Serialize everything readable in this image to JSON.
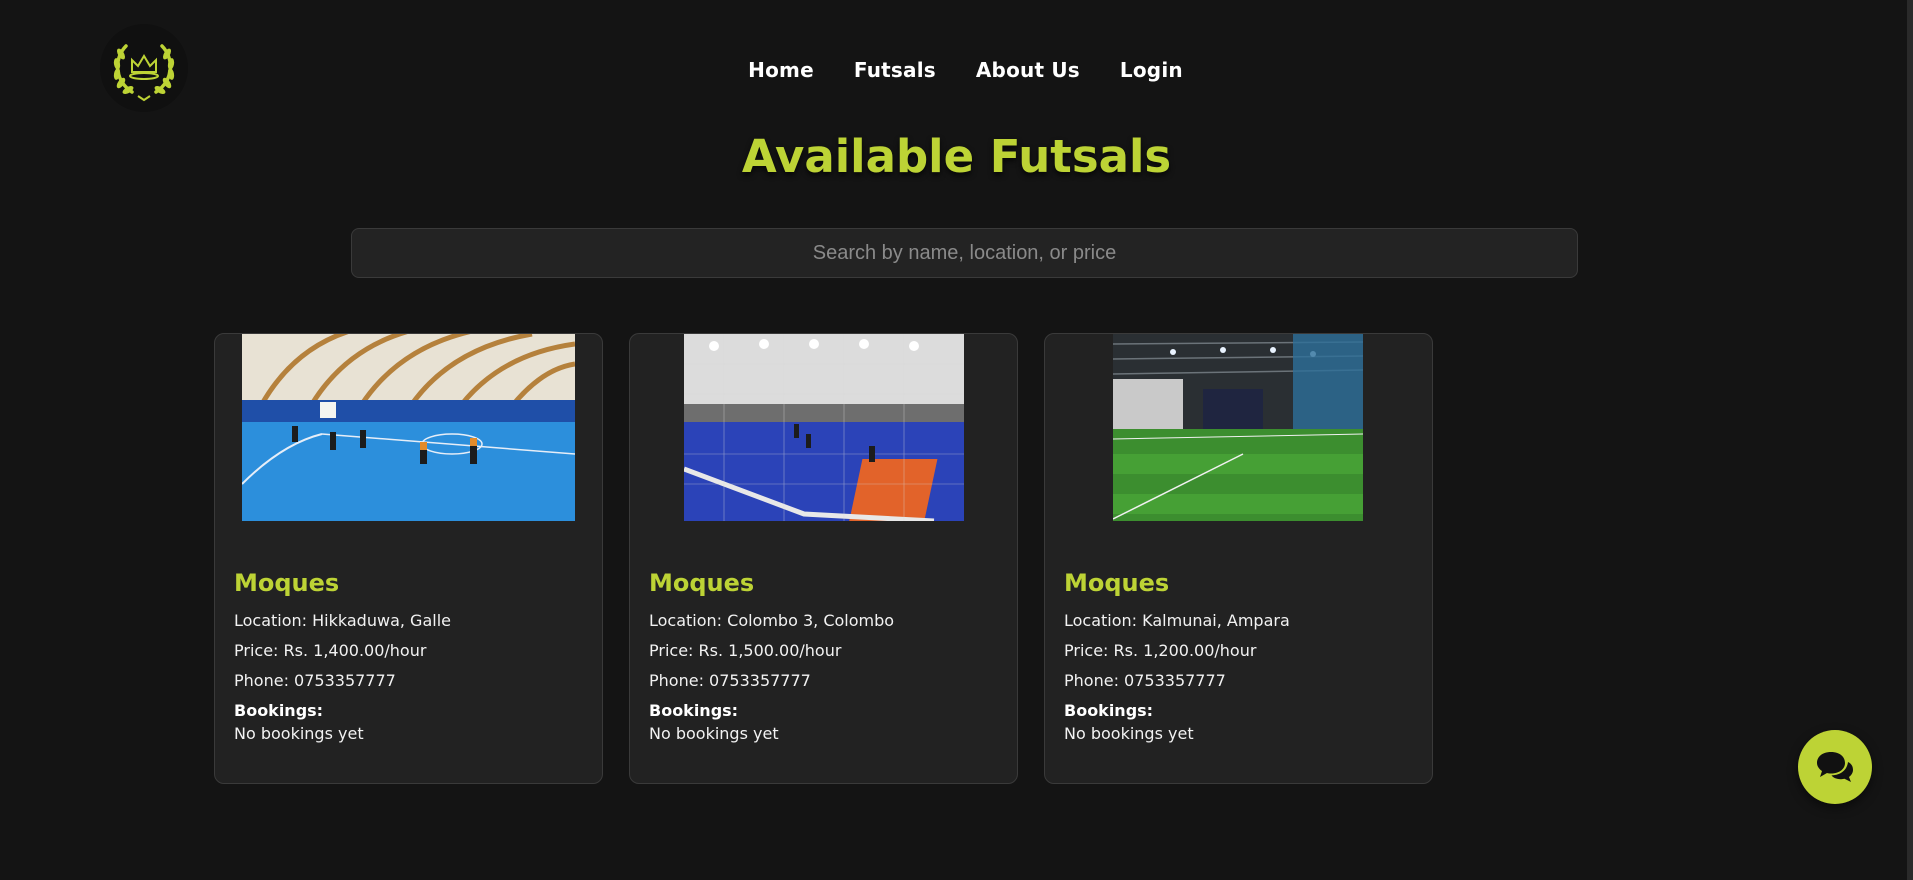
{
  "nav": {
    "items": [
      {
        "label": "Home"
      },
      {
        "label": "Futsals"
      },
      {
        "label": "About Us"
      },
      {
        "label": "Login"
      }
    ]
  },
  "page": {
    "title": "Available Futsals"
  },
  "search": {
    "placeholder": "Search by name, location, or price",
    "value": ""
  },
  "cards": [
    {
      "name": "Moques",
      "location": "Location: Hikkaduwa, Galle",
      "price": "Price: Rs. 1,400.00/hour",
      "phone": "Phone: 0753357777",
      "bookings_label": "Bookings:",
      "bookings_value": "No bookings yet",
      "image": "indoor-futsal-court-blue-dome"
    },
    {
      "name": "Moques",
      "location": "Location: Colombo 3, Colombo",
      "price": "Price: Rs. 1,500.00/hour",
      "phone": "Phone: 0753357777",
      "bookings_label": "Bookings:",
      "bookings_value": "No bookings yet",
      "image": "netted-futsal-court-blue"
    },
    {
      "name": "Moques",
      "location": "Location: Kalmunai, Ampara",
      "price": "Price: Rs. 1,200.00/hour",
      "phone": "Phone: 0753357777",
      "bookings_label": "Bookings:",
      "bookings_value": "No bookings yet",
      "image": "indoor-turf-green"
    }
  ],
  "icons": {
    "logo": "crown-laurel-icon",
    "chat": "chat-bubbles-icon"
  },
  "colors": {
    "accent": "#bdd335",
    "background": "#141414",
    "card": "#222222"
  }
}
